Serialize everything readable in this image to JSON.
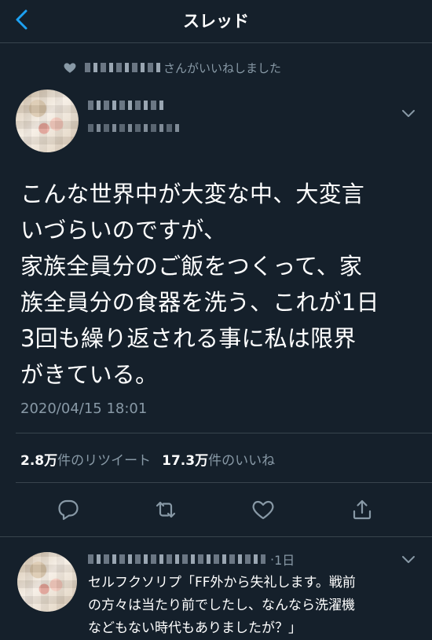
{
  "nav": {
    "title": "スレッド"
  },
  "social_context": {
    "text": "さんがいいねしました"
  },
  "tweet": {
    "text": "こんな世界中が大変な中、大変言\nいづらいのですが、\n家族全員分のご飯をつくって、家\n族全員分の食器を洗う、これが1日\n3回も繰り返される事に私は限界\nがきている。",
    "timestamp": "2020/04/15 18:01",
    "retweets_count": "2.8万",
    "retweets_label": "件のリツイート",
    "likes_count": "17.3万",
    "likes_label": "件のいいね"
  },
  "reply": {
    "time": "1日",
    "text": "セルフクソリプ「FF外から失礼します。戦前\nの方々は当たり前でしたし、なんなら洗濯機\nなどもない時代もありましたが？」"
  },
  "colors": {
    "background": "#15202b",
    "accent": "#1da1f2",
    "muted": "#8899a6",
    "divider": "#38444d"
  },
  "icons": [
    "back-chevron-icon",
    "heart-icon",
    "chevron-down-icon",
    "reply-icon",
    "retweet-icon",
    "like-icon",
    "share-icon"
  ]
}
